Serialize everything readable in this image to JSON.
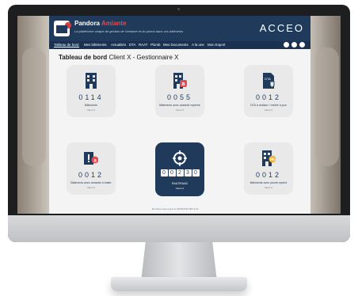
{
  "app": {
    "name": "Pandora",
    "name_accent": "Amiante",
    "tagline": "La plateforme unique de gestion de l'amiante et du plomb dans vos bâtiments",
    "partner_logo": "ACCEO"
  },
  "nav": {
    "items": [
      "Tableau de bord",
      "Mes bâtiments",
      "Actualités",
      "DTA",
      "RAAT",
      "Plomb",
      "Mes Documents",
      "A la une",
      "Mon Export"
    ],
    "active": "Tableau de bord",
    "icons": [
      "info-icon",
      "user-icon",
      "power-icon"
    ]
  },
  "page": {
    "title_bold": "Tableau de bord",
    "title_rest": "Client X - Gestionnaire X"
  },
  "cards": [
    {
      "value": "0114",
      "label": "Bâtiments",
      "sub": "Client X",
      "icon": "building-icon"
    },
    {
      "value": "0055",
      "label": "Bâtiments avec amiante repérée",
      "sub": "Client X",
      "icon": "building-asbestos-icon"
    },
    {
      "value": "0012",
      "label": "DTA à réaliser / mettre à jour",
      "sub": "Client X",
      "icon": "dta-document-icon"
    },
    {
      "value": "0012",
      "label": "Bâtiments avec amiante à traiter",
      "sub": "Client X",
      "icon": "alert-asbestos-icon"
    },
    {
      "value": "00230",
      "label": "RAAT/RAAD",
      "sub": "Client X",
      "icon": "target-icon"
    },
    {
      "value": "0012",
      "label": "Bâtiments avec plomb repéré",
      "sub": "Client X",
      "icon": "building-lead-icon"
    }
  ],
  "footer": {
    "note": "Dernière mise à jour le 30/06/2019 08:12:41"
  },
  "colors": {
    "primary": "#1f3a5a",
    "accent": "#e24b52",
    "card": "#e9e9e9",
    "lead": "#f2b53b"
  }
}
